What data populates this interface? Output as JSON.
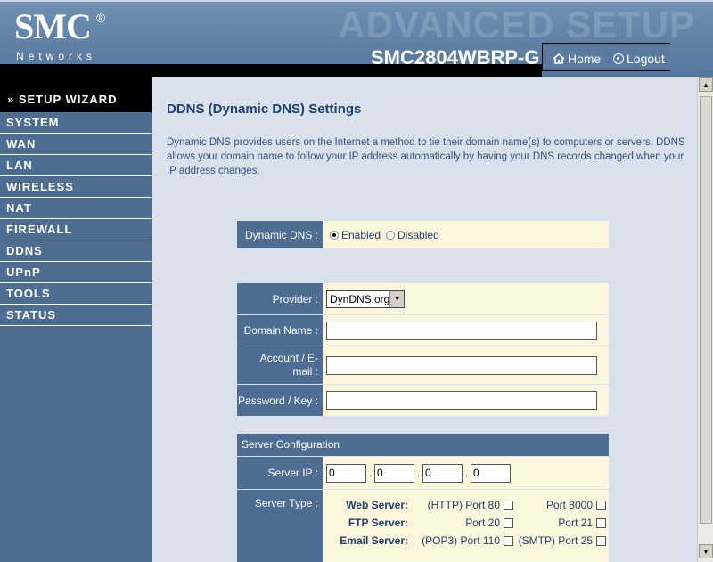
{
  "header": {
    "logo_main": "SMC",
    "logo_reg": "®",
    "logo_sub": "Networks",
    "banner": "ADVANCED SETUP",
    "model": "SMC2804WBRP-G",
    "home_label": "Home",
    "logout_label": "Logout"
  },
  "sidebar": {
    "wizard": "» SETUP WIZARD",
    "items": [
      "SYSTEM",
      "WAN",
      "LAN",
      "WIRELESS",
      "NAT",
      "FIREWALL",
      "DDNS",
      "UPnP",
      "TOOLS",
      "STATUS"
    ]
  },
  "page": {
    "title": "DDNS (Dynamic DNS) Settings",
    "description": "Dynamic DNS provides users on the Internet a method to tie their domain name(s) to computers or servers. DDNS allows your domain name to follow your IP address automatically by having your DNS records changed when your IP address changes."
  },
  "form": {
    "ddns_label": "Dynamic DNS :",
    "enabled_label": "Enabled",
    "disabled_label": "Disabled",
    "ddns_selected": "Enabled",
    "provider_label": "Provider :",
    "provider_value": "DynDNS.org",
    "domain_label": "Domain Name :",
    "domain_value": "",
    "account_label_1": "Account / E-",
    "account_label_2": "mail :",
    "account_value": "",
    "password_label": "Password / Key :",
    "password_value": ""
  },
  "server_config": {
    "header": "Server Configuration",
    "ip_label": "Server IP :",
    "ip": [
      "0",
      "0",
      "0",
      "0"
    ],
    "type_label": "Server Type :",
    "types": [
      {
        "name": "Web Server:",
        "port_a": "(HTTP) Port 80",
        "port_b": "Port 8000"
      },
      {
        "name": "FTP Server:",
        "port_a": "Port 20",
        "port_b": "Port 21"
      },
      {
        "name": "Email Server:",
        "port_a": "(POP3) Port 110",
        "port_b": "(SMTP) Port 25"
      }
    ]
  },
  "colors": {
    "nav_blue": "#4d6d93",
    "content_bg": "#d9e2ec",
    "value_bg": "#fbf6dc",
    "title_blue": "#1f3f6f"
  }
}
